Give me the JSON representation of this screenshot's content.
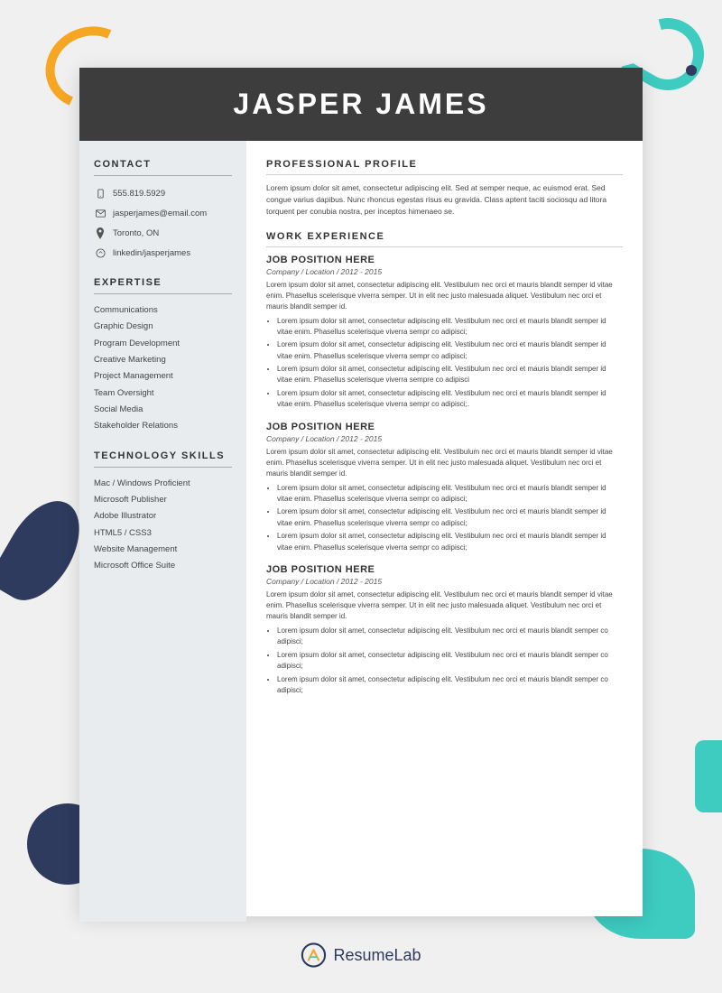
{
  "header": {
    "name": "JASPER JAMES"
  },
  "sidebar": {
    "contact_title": "CONTACT",
    "phone": "555.819.5929",
    "email": "jasperjames@email.com",
    "location": "Toronto, ON",
    "linkedin": "linkedin/jasperjames",
    "expertise_title": "EXPERTISE",
    "expertise_items": [
      "Communications",
      "Graphic Design",
      "Program Development",
      "Creative Marketing",
      "Project Management",
      "Team Oversight",
      "Social Media",
      "Stakeholder Relations"
    ],
    "tech_title": "TECHNOLOGY SKILLS",
    "tech_items": [
      "Mac / Windows Proficient",
      "Microsoft Publisher",
      "Adobe Illustrator",
      "HTML5 / CSS3",
      "Website Management",
      "Microsoft Office Suite"
    ]
  },
  "main": {
    "profile_title": "PROFESSIONAL PROFILE",
    "profile_text": "Lorem ipsum dolor sit amet, consectetur adipiscing elit. Sed at semper neque, ac euismod erat. Sed congue varius dapibus. Nunc rhoncus egestas risus eu gravida. Class aptent taciti sociosqu ad litora torquent per conubia nostra, per inceptos himenaeo se.",
    "work_title": "WORK EXPERIENCE",
    "jobs": [
      {
        "title": "JOB POSITION HERE",
        "meta": "Company / Location / 2012 - 2015",
        "desc": "Lorem ipsum dolor sit amet, consectetur adipiscing elit. Vestibulum nec orci et mauris blandit semper id vitae enim. Phasellus scelerisque viverra semper. Ut in elit nec justo malesuada aliquet. Vestibulum nec orci et mauris blandit semper id.",
        "bullets": [
          "Lorem ipsum dolor sit amet, consectetur adipiscing elit. Vestibulum nec orci et mauris blandit semper id vitae enim. Phasellus scelerisque viverra sempr co adipisci;",
          "Lorem ipsum dolor sit amet, consectetur adipiscing elit. Vestibulum nec orci et mauris blandit semper id vitae enim. Phasellus scelerisque viverra sempr co adipisci;",
          "Lorem ipsum dolor sit amet, consectetur adipiscing elit. Vestibulum nec orci et mauris blandit semper id vitae enim. Phasellus scelerisque viverra sempre co adipisci",
          "Lorem ipsum dolor sit amet, consectetur adipiscing elit. Vestibulum nec orci et mauris blandit semper id vitae enim. Phasellus scelerisque viverra sempr co adipisci;."
        ]
      },
      {
        "title": "JOB POSITION HERE",
        "meta": "Company / Location /  2012 - 2015",
        "desc": "Lorem ipsum dolor sit amet, consectetur adipiscing elit. Vestibulum nec orci et mauris blandit semper id vitae enim. Phasellus scelerisque viverra semper. Ut in elit nec justo malesuada aliquet. Vestibulum nec orci et mauris blandit semper id.",
        "bullets": [
          "Lorem ipsum dolor sit amet, consectetur adipiscing elit. Vestibulum nec orci et mauris blandit semper id vitae enim. Phasellus scelerisque viverra sempr co adipisci;",
          "Lorem ipsum dolor sit amet, consectetur adipiscing elit. Vestibulum nec orci et mauris blandit semper id vitae enim. Phasellus scelerisque viverra sempr co adipisci;",
          "Lorem ipsum dolor sit amet, consectetur adipiscing elit. Vestibulum nec orci et mauris blandit semper id vitae enim. Phasellus scelerisque viverra sempr co adipisci;"
        ]
      },
      {
        "title": "JOB POSITION HERE",
        "meta": "Company / Location / 2012 - 2015",
        "desc": "Lorem ipsum dolor sit amet, consectetur adipiscing elit. Vestibulum nec orci et mauris blandit semper id vitae enim. Phasellus scelerisque viverra semper. Ut in elit nec justo malesuada aliquet. Vestibulum nec orci et mauris blandit semper id.",
        "bullets": [
          "Lorem ipsum dolor sit amet, consectetur adipiscing elit. Vestibulum nec orci et mauris blandit semper co adipisci;",
          "Lorem ipsum dolor sit amet, consectetur adipiscing elit. Vestibulum nec orci et mauris blandit semper co adipisci;",
          "Lorem ipsum dolor sit amet, consectetur adipiscing elit. Vestibulum nec orci et mauris blandit semper co adipisci;"
        ]
      }
    ]
  },
  "brand": {
    "name_bold": "Resume",
    "name_light": "Lab"
  }
}
